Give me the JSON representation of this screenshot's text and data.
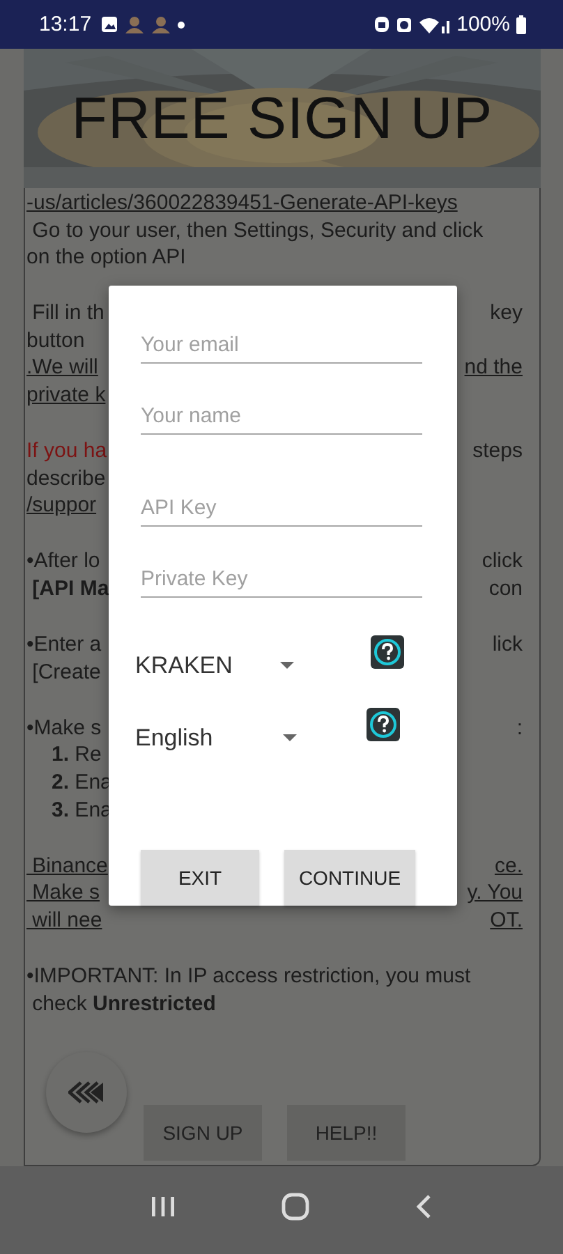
{
  "status_bar": {
    "time": "13:17",
    "battery": "100%"
  },
  "header": {
    "title": "FREE SIGN UP"
  },
  "instructions": [
    [
      {
        "left": {
          "text": "-us/articles/360022839451-Generate-API-keys",
          "kind": "link"
        }
      },
      {
        "left": {
          "text": " Go to your user, then Settings, Security and click",
          "kind": "plain"
        }
      },
      {
        "left": {
          "text": "on the option API",
          "kind": "plain"
        }
      }
    ],
    [
      {
        "left": {
          "text": " Fill in th",
          "kind": "plain"
        },
        "right": {
          "text": "key",
          "kind": "plain"
        }
      },
      {
        "left": {
          "text": "button",
          "kind": "plain"
        }
      },
      {
        "left": {
          "text": ".We will",
          "kind": "link"
        },
        "right": {
          "text": "nd the",
          "kind": "link"
        }
      },
      {
        "left": {
          "text": "private k",
          "kind": "link"
        }
      }
    ],
    [
      {
        "left": {
          "text": "If you ha",
          "kind": "warning"
        },
        "right": {
          "text": "steps",
          "kind": "plain"
        }
      },
      {
        "left": {
          "text": "describe",
          "kind": "plain"
        }
      },
      {
        "left": {
          "text": "/suppor",
          "kind": "link"
        }
      }
    ],
    [
      {
        "left": {
          "text": "•After lo",
          "kind": "plain"
        },
        "right": {
          "text": "click",
          "kind": "plain"
        }
      },
      {
        "left": {
          "text": " [API Ma",
          "kind": "bold"
        },
        "right": {
          "text": "con",
          "kind": "plain"
        }
      }
    ],
    [
      {
        "left": {
          "text": "•Enter a",
          "kind": "plain"
        },
        "right": {
          "text": "lick",
          "kind": "plain"
        }
      },
      {
        "left": {
          "text": " [Create",
          "kind": "plain"
        }
      }
    ],
    [
      {
        "left": {
          "text": "•Make s",
          "kind": "plain"
        },
        "right": {
          "text": ":",
          "kind": "plain"
        }
      },
      {
        "left": {
          "text": "**1.** Re",
          "kind": "list_item"
        }
      },
      {
        "left": {
          "text": "**2.** Ena",
          "kind": "list_item"
        }
      },
      {
        "left": {
          "text": "**3.** Ena",
          "kind": "list_item"
        }
      }
    ],
    [
      {
        "left": {
          "text": " Binance",
          "kind": "link"
        },
        "right": {
          "text": "ce.",
          "kind": "link"
        }
      },
      {
        "left": {
          "text": " Make s",
          "kind": "link"
        },
        "right": {
          "text": "y. You",
          "kind": "link"
        }
      },
      {
        "left": {
          "text": " will nee",
          "kind": "link"
        },
        "right": {
          "text": "OT.",
          "kind": "link"
        }
      }
    ],
    [
      {
        "left": {
          "text": "•IMPORTANT: In IP access restriction, you must",
          "kind": "plain"
        }
      },
      {
        "left": {
          "text": " check **Unrestricted**",
          "kind": "plain"
        }
      }
    ]
  ],
  "dialog": {
    "fields": [
      {
        "placeholder": "Your email"
      },
      {
        "placeholder": "Your name"
      },
      {
        "placeholder": "API Key"
      },
      {
        "placeholder": "Private Key"
      }
    ],
    "dropdowns": [
      {
        "value": "KRAKEN"
      },
      {
        "value": "English"
      }
    ],
    "buttons": [
      "EXIT",
      "CONTINUE"
    ]
  },
  "bottom_buttons": [
    "SIGN UP",
    "HELP!!"
  ]
}
